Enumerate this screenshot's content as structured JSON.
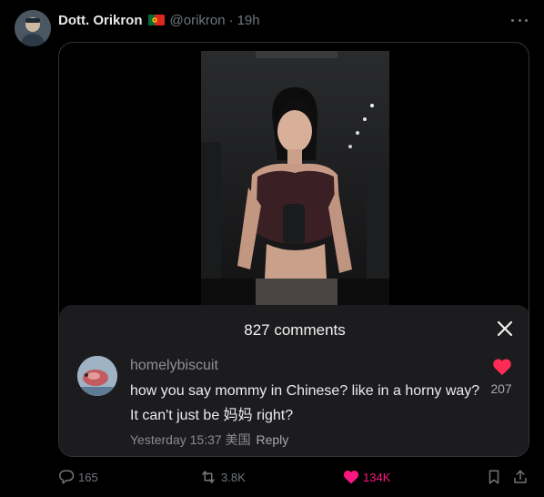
{
  "post": {
    "author_name": "Dott. Orikron",
    "flag_icon": "portugal-flag-icon",
    "handle": "@orikron",
    "separator": "·",
    "time": "19h"
  },
  "comments_panel": {
    "count_label": "827 comments",
    "comment": {
      "username": "homelybiscuit",
      "text": "how you say mommy in Chinese? like in a horny way? It can't just be 妈妈 right?",
      "date": "Yesterday 15:37",
      "location": "美国",
      "reply_label": "Reply",
      "like_count": "207"
    }
  },
  "actions": {
    "replies": "165",
    "reposts": "3.8K",
    "likes": "134K"
  },
  "colors": {
    "background": "#000000",
    "muted_text": "#71767b",
    "like_pink": "#f91880",
    "heart_red": "#fe2c55",
    "panel_bg": "#1c1c1e"
  }
}
